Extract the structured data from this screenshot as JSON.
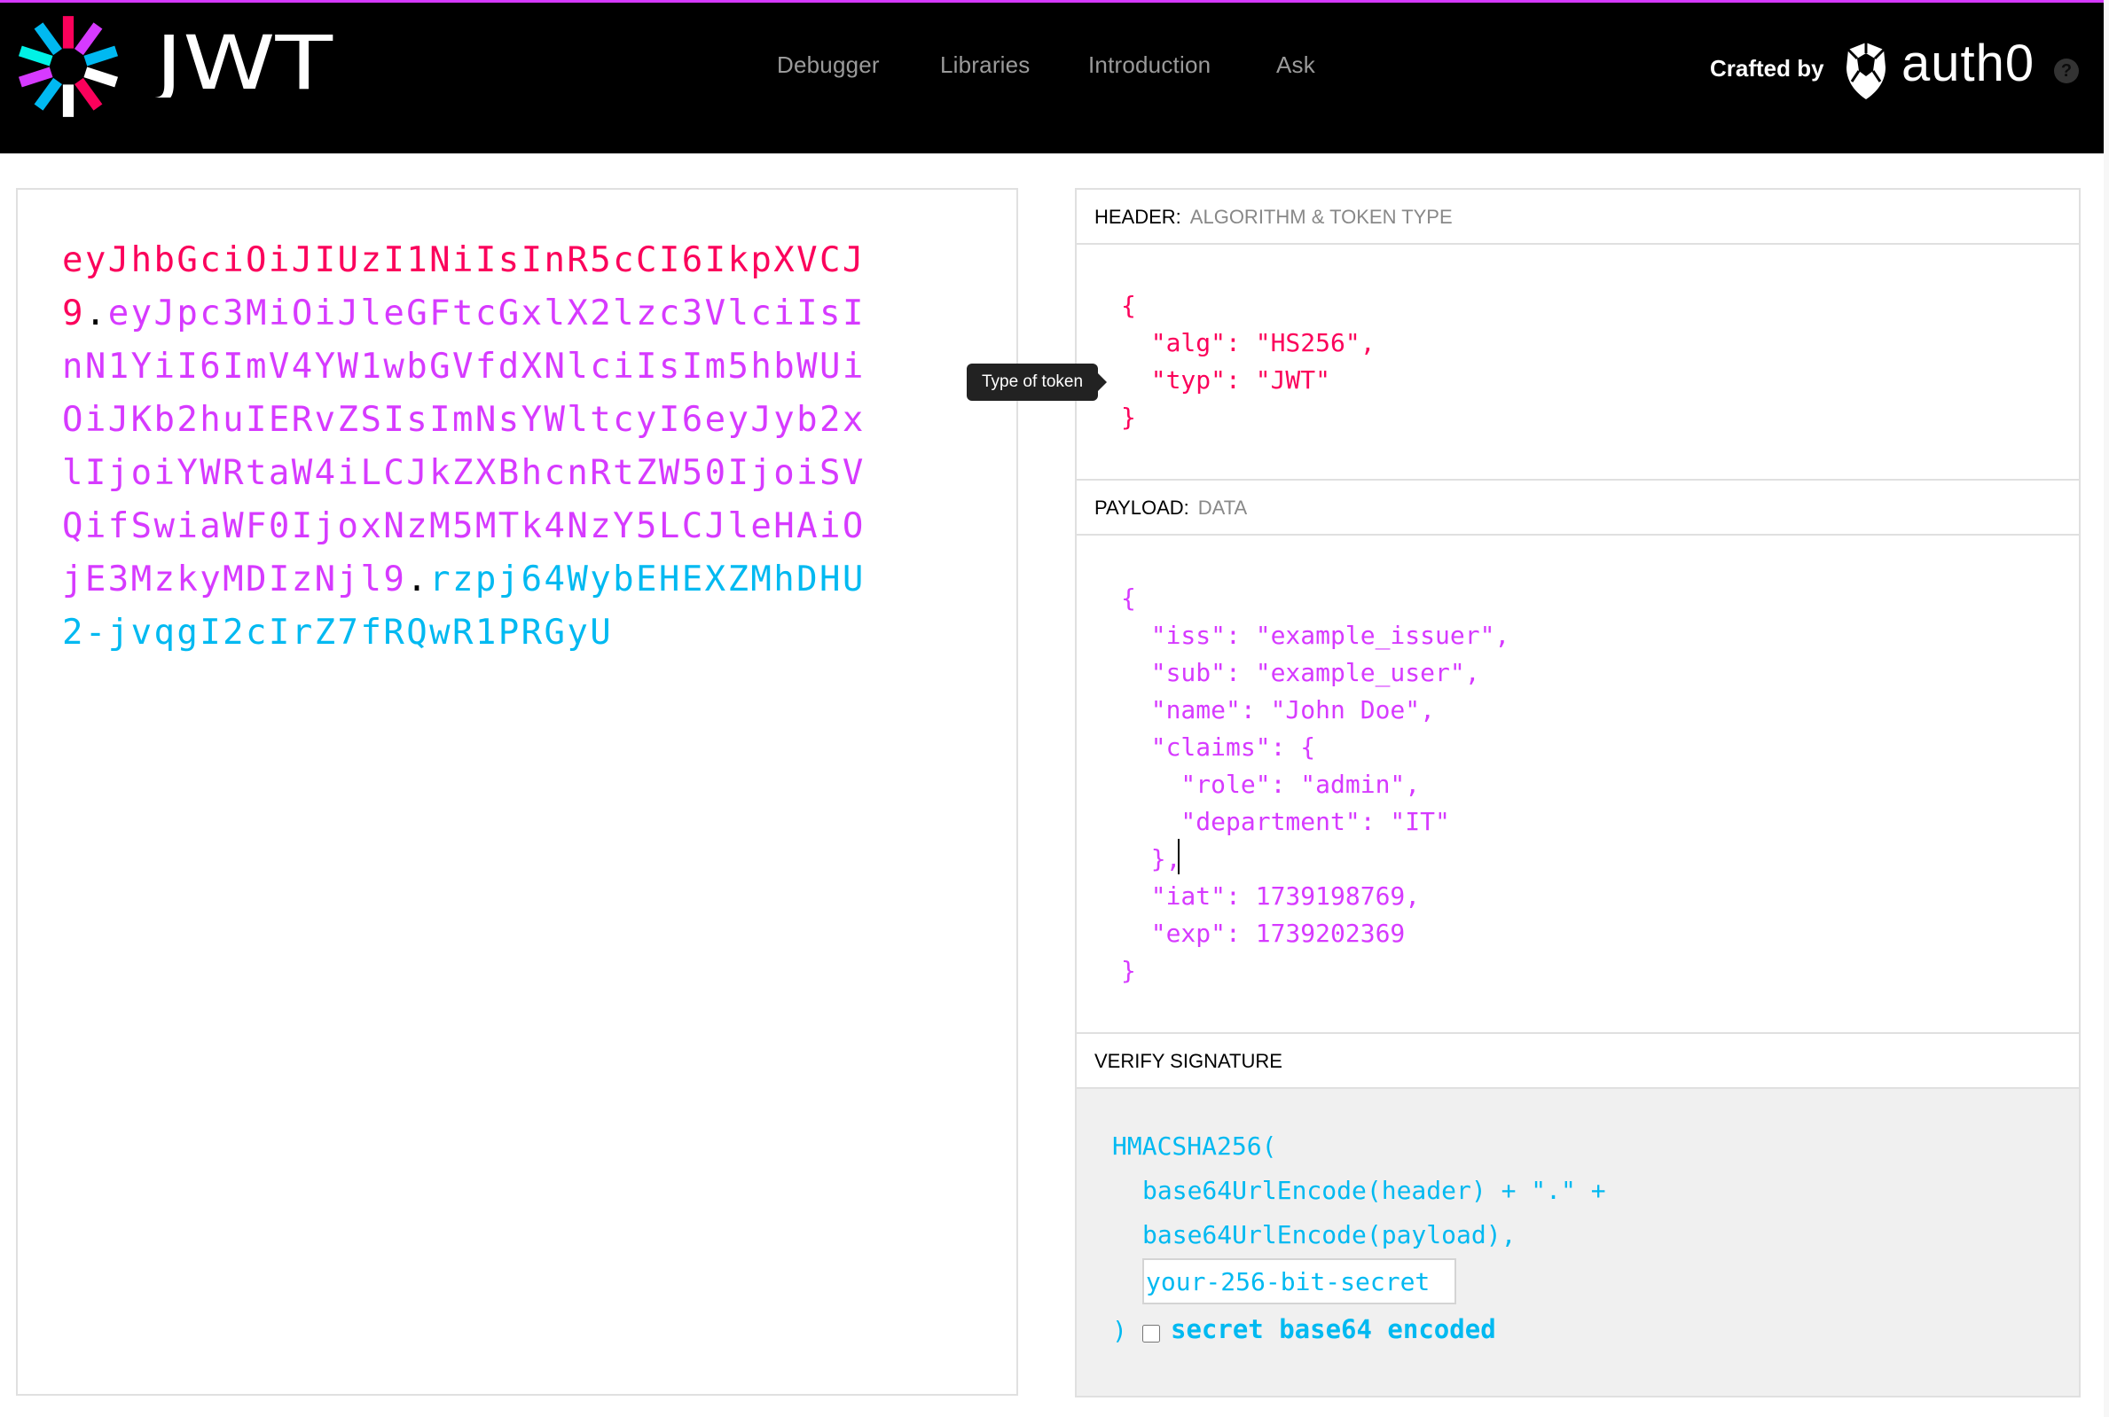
{
  "topbar": {
    "brand": "JWT",
    "nav": [
      "Debugger",
      "Libraries",
      "Introduction",
      "Ask"
    ],
    "crafted_by": "Crafted by",
    "partner": "auth0",
    "help_icon": "?",
    "colors": {
      "header": "#fb015b",
      "payload": "#d63aff",
      "signature": "#00b9f1"
    }
  },
  "encoded": {
    "header_part": "eyJhbGciOiJIUzI1NiIsInR5cCI6IkpXVCJ9",
    "dot1": ".",
    "payload_part": "eyJpc3MiOiJleGFtcGxlX2lzc3VlciIsInN1YiI6ImV4YW1wbGVfdXNlciIsIm5hbWUiOiJKb2huIERvZSIsImNsYWltcyI6eyJyb2xlIjoiYWRtaW4iLCJkZXBhcnRtZW50IjoiSVQifSwiaWF0IjoxNzM5MTk4NzY5LCJleHAiOjE3MzkyMDIzNjl9",
    "dot2": ".",
    "signature_part": "rzpj64WybEHEXZMhDHU2-jvqgI2cIrZ7fRQwR1PRGyU"
  },
  "decoded": {
    "header": {
      "title": "HEADER:",
      "subtitle": "ALGORITHM & TOKEN TYPE",
      "json": "{\n  \"alg\": \"HS256\",\n  \"typ\": \"JWT\"\n}"
    },
    "payload": {
      "title": "PAYLOAD:",
      "subtitle": "DATA",
      "json": "{\n  \"iss\": \"example_issuer\",\n  \"sub\": \"example_user\",\n  \"name\": \"John Doe\",\n  \"claims\": {\n    \"role\": \"admin\",\n    \"department\": \"IT\"\n  },\n  \"iat\": 1739198769,\n  \"exp\": 1739202369\n}"
    },
    "verify": {
      "title": "VERIFY SIGNATURE",
      "line1": "HMACSHA256(",
      "line2": "base64UrlEncode(header) + \".\" +",
      "line3": "base64UrlEncode(payload),",
      "secret_placeholder": "your-256-bit-secret",
      "close": ")",
      "b64_label": "secret base64 encoded"
    }
  },
  "tooltip": "Type of token"
}
